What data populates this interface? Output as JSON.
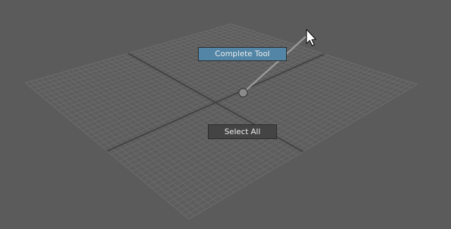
{
  "viewport": {
    "background_color": "#5b5b5b",
    "grid_line_color": "#6e6e6e",
    "grid_axis_color": "#3e3e3e",
    "grid_divisions": 40
  },
  "marking_menu": {
    "selected_item": {
      "label": "Complete Tool",
      "color": "#5285a6"
    },
    "items": [
      {
        "label": "Select All",
        "color": "#444444"
      }
    ],
    "gesture_line_color": "#9a9a9a",
    "center_marker_color": "#8a8a8a"
  },
  "cursor": {
    "icon": "arrow-cursor-icon"
  }
}
